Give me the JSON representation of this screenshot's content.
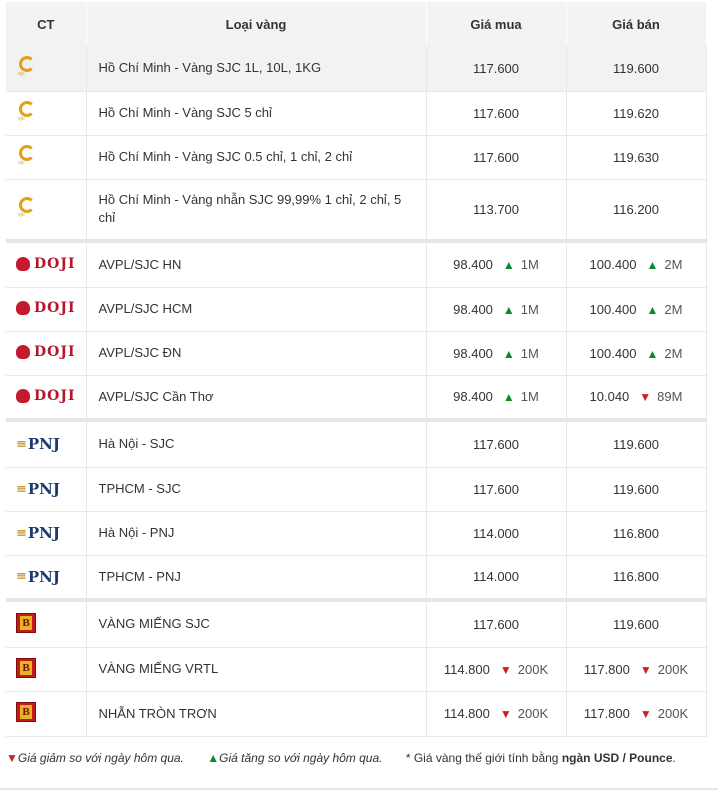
{
  "header": {
    "ct": "CT",
    "type": "Loại vàng",
    "buy": "Giá mua",
    "sell": "Giá bán"
  },
  "colors": {
    "up": "#0b8a2a",
    "down": "#d21e1e"
  },
  "rows": [
    {
      "logo": "sjc-logo",
      "name": "Hồ Chí Minh - Vàng SJC 1L, 10L, 1KG",
      "buy": "117.600",
      "sell": "119.600"
    },
    {
      "logo": "sjc-logo",
      "name": "Hồ Chí Minh - Vàng SJC 5 chỉ",
      "buy": "117.600",
      "sell": "119.620"
    },
    {
      "logo": "sjc-logo",
      "name": "Hồ Chí Minh - Vàng SJC 0.5 chỉ, 1 chỉ, 2 chỉ",
      "buy": "117.600",
      "sell": "119.630"
    },
    {
      "logo": "sjc-logo",
      "name": "Hồ Chí Minh - Vàng nhẫn SJC 99,99% 1 chỉ, 2 chỉ, 5 chỉ",
      "buy": "113.700",
      "sell": "116.200"
    },
    {
      "logo": "doji-logo",
      "logo_text": "DOJI",
      "name": "AVPL/SJC HN",
      "buy": "98.400",
      "buy_dir": "up",
      "buy_chg": "1M",
      "sell": "100.400",
      "sell_dir": "up",
      "sell_chg": "2M"
    },
    {
      "logo": "doji-logo",
      "logo_text": "DOJI",
      "name": "AVPL/SJC HCM",
      "buy": "98.400",
      "buy_dir": "up",
      "buy_chg": "1M",
      "sell": "100.400",
      "sell_dir": "up",
      "sell_chg": "2M"
    },
    {
      "logo": "doji-logo",
      "logo_text": "DOJI",
      "name": "AVPL/SJC ĐN",
      "buy": "98.400",
      "buy_dir": "up",
      "buy_chg": "1M",
      "sell": "100.400",
      "sell_dir": "up",
      "sell_chg": "2M"
    },
    {
      "logo": "doji-logo",
      "logo_text": "DOJI",
      "name": "AVPL/SJC Cần Thơ",
      "buy": "98.400",
      "buy_dir": "up",
      "buy_chg": "1M",
      "sell": "10.040",
      "sell_dir": "down",
      "sell_chg": "89M"
    },
    {
      "logo": "pnj-logo",
      "logo_text": "PNJ",
      "name": "Hà Nội - SJC",
      "buy": "117.600",
      "sell": "119.600"
    },
    {
      "logo": "pnj-logo",
      "logo_text": "PNJ",
      "name": "TPHCM - SJC",
      "buy": "117.600",
      "sell": "119.600"
    },
    {
      "logo": "pnj-logo",
      "logo_text": "PNJ",
      "name": "Hà Nội - PNJ",
      "buy": "114.000",
      "sell": "116.800"
    },
    {
      "logo": "pnj-logo",
      "logo_text": "PNJ",
      "name": "TPHCM - PNJ",
      "buy": "114.000",
      "sell": "116.800"
    },
    {
      "logo": "btmc-logo",
      "name": "VÀNG MIẾNG SJC",
      "buy": "117.600",
      "sell": "119.600"
    },
    {
      "logo": "btmc-logo",
      "name": "VÀNG MIẾNG VRTL",
      "buy": "114.800",
      "buy_dir": "down",
      "buy_chg": "200K",
      "sell": "117.800",
      "sell_dir": "down",
      "sell_chg": "200K"
    },
    {
      "logo": "btmc-logo",
      "name": "NHẪN TRÒN TRƠN",
      "buy": "114.800",
      "buy_dir": "down",
      "buy_chg": "200K",
      "sell": "117.800",
      "sell_dir": "down",
      "sell_chg": "200K"
    }
  ],
  "notes": {
    "down_arrow": "▼",
    "down_text": "Giá giảm so với ngày hôm qua.",
    "up_arrow": "▲",
    "up_text": "Giá tăng so với ngày hôm qua.",
    "world_prefix": "* Giá vàng thế giới tính bằng ",
    "world_unit": "ngàn USD / Pounce",
    "world_suffix": "."
  }
}
